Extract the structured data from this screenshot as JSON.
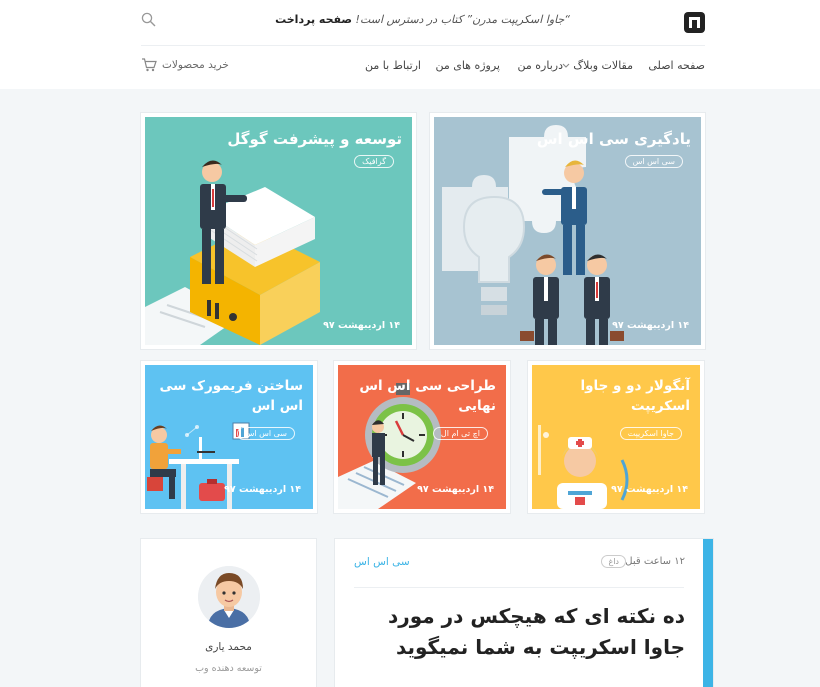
{
  "header": {
    "promo_text": "“جاوا اسکریپت مدرن” کتاب در دسترس است!",
    "promo_link": "صفحه پرداخت",
    "nav": {
      "home": "صفحه اصلی",
      "blog": "مقالات وبلاگ",
      "about": "درباره من",
      "projects": "پروژه های من",
      "contact": "ارتباط با من"
    },
    "cart_label": "خرید محصولات"
  },
  "cards": [
    {
      "title": "یادگیری سی اس اس",
      "badge": "سی اس اس",
      "date": "۱۴ اردیبهشت ۹۷",
      "bg": "#a7c3d1"
    },
    {
      "title": "توسعه و پیشرفت گوگل",
      "badge": "گرافیک",
      "date": "۱۴ اردیبهشت ۹۷",
      "bg": "#6cc7bd"
    },
    {
      "title": "آنگولار دو و جاوا اسکریپت",
      "badge": "جاوا اسکریپت",
      "date": "۱۴ اردیبهشت ۹۷",
      "bg": "#ffc84a"
    },
    {
      "title": "طراحی سی اس اس نهایی",
      "badge": "اچ تی ام ال",
      "date": "۱۴ اردیبهشت ۹۷",
      "bg": "#f26d4a"
    },
    {
      "title": "ساختن فریمورک سی اس اس",
      "badge": "سی اس اس",
      "date": "۱۴ اردیبهشت ۹۷",
      "bg": "#5ec2f2"
    }
  ],
  "author": {
    "name": "محمد یاری",
    "role": "توسعه دهنده وب"
  },
  "post": {
    "time": "۱۲ ساعت قبل",
    "tag": "داغ",
    "category": "سی اس اس",
    "title": "ده نکته ای که هیچکس در مورد جاوا اسکریپت به شما نمیگوید",
    "accent": "#3cb4e6"
  }
}
